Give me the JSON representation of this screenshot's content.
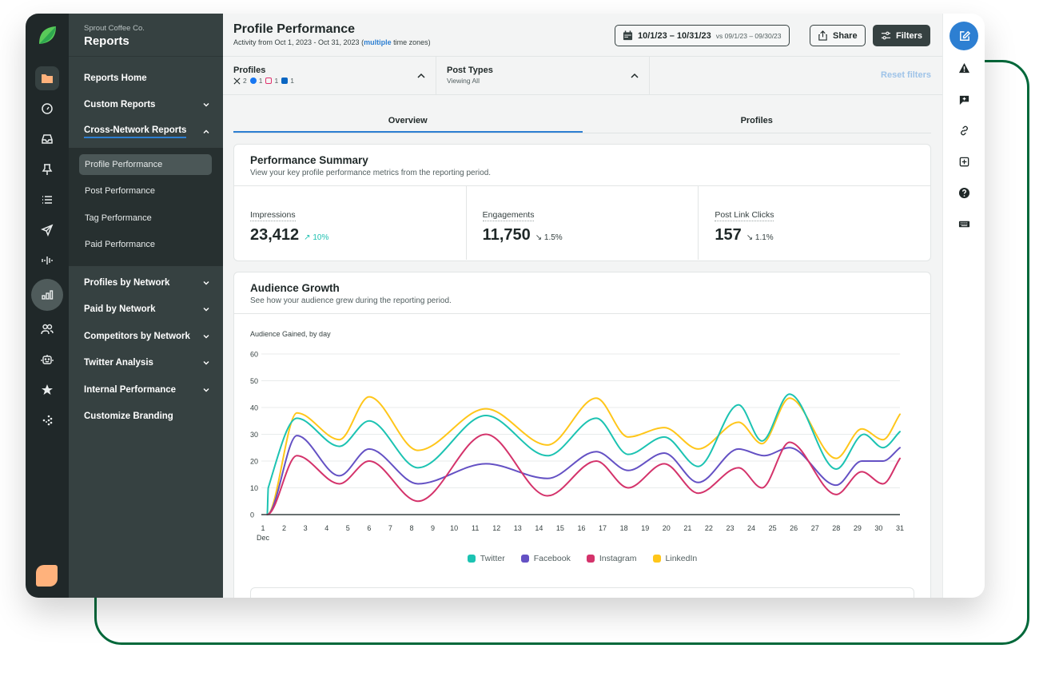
{
  "nav": {
    "org": "Sprout Coffee Co.",
    "title": "Reports",
    "items_top": [
      {
        "label": "Reports Home",
        "chevron": null
      },
      {
        "label": "Custom Reports",
        "chevron": "down"
      },
      {
        "label": "Cross-Network Reports",
        "chevron": "up"
      }
    ],
    "sub_items": [
      {
        "label": "Profile Performance",
        "active": true
      },
      {
        "label": "Post Performance",
        "active": false
      },
      {
        "label": "Tag Performance",
        "active": false
      },
      {
        "label": "Paid Performance",
        "active": false
      }
    ],
    "items_bottom": [
      {
        "label": "Profiles by Network",
        "chevron": "down"
      },
      {
        "label": "Paid by Network",
        "chevron": "down"
      },
      {
        "label": "Competitors by Network",
        "chevron": "down"
      },
      {
        "label": "Twitter Analysis",
        "chevron": "down"
      },
      {
        "label": "Internal Performance",
        "chevron": "down"
      },
      {
        "label": "Customize Branding",
        "chevron": null
      }
    ]
  },
  "rail": {
    "icons": [
      "folder-icon",
      "gauge-icon",
      "inbox-icon",
      "pin-icon",
      "list-icon",
      "send-icon",
      "listening-icon",
      "reports-icon",
      "people-icon",
      "bot-icon",
      "star-icon",
      "network-icon"
    ]
  },
  "header": {
    "title": "Profile Performance",
    "subtitle_pre": "Activity from Oct 1, 2023 - Oct 31, 2023 (",
    "subtitle_highlight": "multiple",
    "subtitle_post": " time zones)",
    "date_range": "10/1/23 – 10/31/23",
    "compare_range": "vs 09/1/23 – 09/30/23",
    "share_label": "Share",
    "filters_label": "Filters"
  },
  "filters": {
    "profiles_label": "Profiles",
    "profiles_counts": [
      {
        "network": "X",
        "count": "2"
      },
      {
        "network": "Facebook",
        "count": "1"
      },
      {
        "network": "Instagram",
        "count": "1"
      },
      {
        "network": "LinkedIn",
        "count": "1"
      }
    ],
    "post_types_label": "Post Types",
    "post_types_value": "Viewing All",
    "reset_label": "Reset filters"
  },
  "tabs": [
    {
      "label": "Overview",
      "active": true
    },
    {
      "label": "Profiles",
      "active": false
    }
  ],
  "summary": {
    "title": "Performance Summary",
    "subtitle": "View your key profile performance metrics from the reporting period.",
    "metrics": [
      {
        "label": "Impressions",
        "value": "23,412",
        "delta": "↗ 10%",
        "direction": "up"
      },
      {
        "label": "Engagements",
        "value": "11,750",
        "delta": "↘ 1.5%",
        "direction": "down"
      },
      {
        "label": "Post Link Clicks",
        "value": "157",
        "delta": "↘ 1.1%",
        "direction": "down"
      }
    ]
  },
  "growth": {
    "title": "Audience Growth",
    "subtitle": "See how your audience grew during the reporting period."
  },
  "colors": {
    "accent": "#2d7fd2",
    "twitter": "#1cc3b2",
    "facebook": "#6451c4",
    "instagram": "#d4336b",
    "linkedin": "#ffc61a",
    "frame": "#00683a"
  },
  "chart_data": {
    "type": "line",
    "title": "Audience Gained, by day",
    "xlabel": "Dec",
    "ylabel": "",
    "x": [
      1,
      2,
      3,
      4,
      5,
      6,
      7,
      8,
      9,
      10,
      11,
      12,
      13,
      14,
      15,
      16,
      17,
      18,
      19,
      20,
      21,
      22,
      23,
      24,
      25,
      26,
      27,
      28,
      29,
      30,
      31
    ],
    "x_tick_labels": [
      "1",
      "2",
      "3",
      "4",
      "5",
      "6",
      "7",
      "8",
      "9",
      "10",
      "11",
      "12",
      "13",
      "14",
      "15",
      "16",
      "17",
      "18",
      "19",
      "20",
      "21",
      "22",
      "23",
      "24",
      "25",
      "26",
      "27",
      "28",
      "29",
      "30",
      "31"
    ],
    "y_ticks": [
      0,
      10,
      20,
      30,
      40,
      50,
      60
    ],
    "ylim": [
      0,
      60
    ],
    "xlim": [
      1,
      31
    ],
    "grid": true,
    "legend": "bottom",
    "series": [
      {
        "name": "Twitter",
        "color": "#1cc3b2",
        "points": [
          [
            1.2,
            0
          ],
          [
            1.25,
            10
          ],
          [
            2.6,
            36
          ],
          [
            4.6,
            25.5
          ],
          [
            6.0,
            35
          ],
          [
            8.3,
            17.5
          ],
          [
            11.5,
            37
          ],
          [
            14.4,
            22
          ],
          [
            16.7,
            36
          ],
          [
            18.2,
            22.5
          ],
          [
            19.9,
            29
          ],
          [
            21.5,
            18
          ],
          [
            23.4,
            41
          ],
          [
            24.5,
            27.5
          ],
          [
            25.8,
            45
          ],
          [
            28.0,
            17
          ],
          [
            29.3,
            30
          ],
          [
            30.2,
            25
          ],
          [
            31,
            31
          ]
        ]
      },
      {
        "name": "Facebook",
        "color": "#6451c4",
        "points": [
          [
            1.2,
            0
          ],
          [
            2.6,
            29.5
          ],
          [
            4.6,
            14.5
          ],
          [
            6.0,
            24.5
          ],
          [
            8.3,
            11.5
          ],
          [
            11.5,
            19
          ],
          [
            14.4,
            13.5
          ],
          [
            16.7,
            23.5
          ],
          [
            18.2,
            16.5
          ],
          [
            19.9,
            23
          ],
          [
            21.5,
            12
          ],
          [
            23.4,
            24.5
          ],
          [
            24.6,
            22
          ],
          [
            25.8,
            25
          ],
          [
            28.0,
            11
          ],
          [
            29.2,
            20
          ],
          [
            30.2,
            20
          ],
          [
            31,
            25
          ]
        ]
      },
      {
        "name": "Instagram",
        "color": "#d4336b",
        "points": [
          [
            1.2,
            0
          ],
          [
            2.6,
            22
          ],
          [
            4.6,
            11.5
          ],
          [
            6.0,
            20
          ],
          [
            8.3,
            5
          ],
          [
            11.5,
            30
          ],
          [
            14.4,
            7
          ],
          [
            16.7,
            20
          ],
          [
            18.2,
            10
          ],
          [
            19.9,
            19
          ],
          [
            21.5,
            8
          ],
          [
            23.4,
            17.5
          ],
          [
            24.5,
            10
          ],
          [
            25.8,
            27
          ],
          [
            28.0,
            7.5
          ],
          [
            29.2,
            16
          ],
          [
            30.2,
            11.5
          ],
          [
            31,
            21
          ]
        ]
      },
      {
        "name": "LinkedIn",
        "color": "#ffc61a",
        "points": [
          [
            1.2,
            0
          ],
          [
            2.6,
            38
          ],
          [
            4.6,
            28
          ],
          [
            6.0,
            44
          ],
          [
            8.3,
            24
          ],
          [
            11.5,
            39.5
          ],
          [
            14.4,
            26
          ],
          [
            16.7,
            43.5
          ],
          [
            18.2,
            29
          ],
          [
            19.9,
            32.5
          ],
          [
            21.5,
            24.5
          ],
          [
            23.4,
            34.5
          ],
          [
            24.5,
            26.5
          ],
          [
            25.8,
            43.5
          ],
          [
            28.0,
            21
          ],
          [
            29.2,
            32
          ],
          [
            30.2,
            28
          ],
          [
            31,
            37.5
          ]
        ]
      }
    ]
  }
}
